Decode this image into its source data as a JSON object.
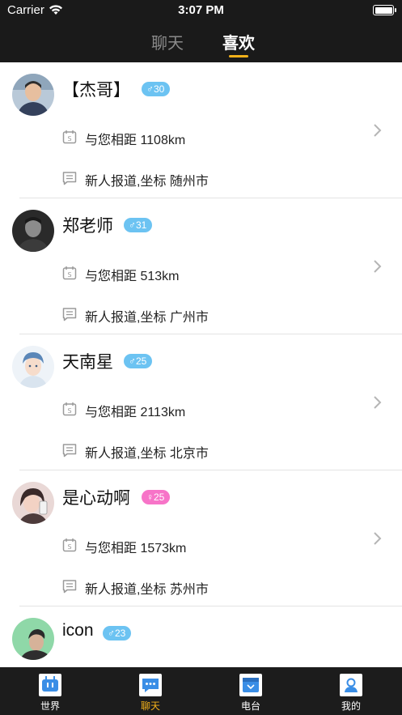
{
  "status_bar": {
    "carrier": "Carrier",
    "time": "3:07 PM"
  },
  "top_tabs": [
    {
      "label": "聊天",
      "active": false
    },
    {
      "label": "喜欢",
      "active": true
    }
  ],
  "colors": {
    "accent": "#f3b11a",
    "male_badge": "#6cc3f2",
    "female_badge": "#f774c8",
    "header_bg": "#1a1a1a"
  },
  "users": [
    {
      "name": "【杰哥】",
      "gender": "male",
      "gender_symbol": "♂",
      "age": "30",
      "distance": "与您相距 1108km",
      "note": "新人报道,坐标 随州市"
    },
    {
      "name": "郑老师",
      "gender": "male",
      "gender_symbol": "♂",
      "age": "31",
      "distance": "与您相距 513km",
      "note": "新人报道,坐标 广州市"
    },
    {
      "name": "天南星",
      "gender": "male",
      "gender_symbol": "♂",
      "age": "25",
      "distance": "与您相距 2113km",
      "note": "新人报道,坐标 北京市"
    },
    {
      "name": "是心动啊",
      "gender": "female",
      "gender_symbol": "♀",
      "age": "25",
      "distance": "与您相距 1573km",
      "note": "新人报道,坐标 苏州市"
    },
    {
      "name": "icon",
      "gender": "male",
      "gender_symbol": "♂",
      "age": "23",
      "distance": "",
      "note": ""
    }
  ],
  "tabbar": [
    {
      "label": "世界",
      "icon": "world-icon",
      "active": false
    },
    {
      "label": "聊天",
      "icon": "chat-icon",
      "active": true
    },
    {
      "label": "电台",
      "icon": "radio-icon",
      "active": false
    },
    {
      "label": "我的",
      "icon": "profile-icon",
      "active": false
    }
  ]
}
